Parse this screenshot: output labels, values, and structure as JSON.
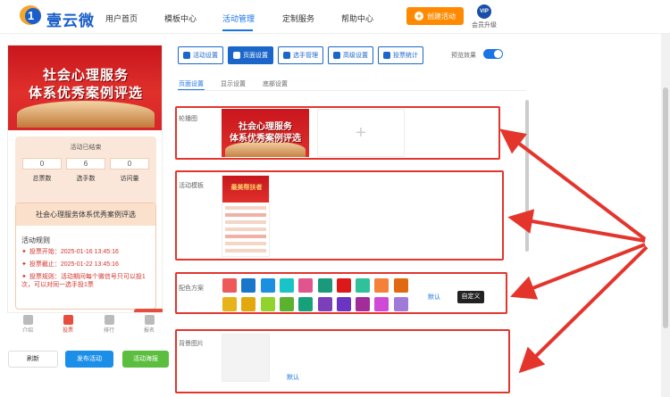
{
  "header": {
    "brand": "壹云微",
    "logo_digit": "1",
    "nav": [
      {
        "label": "用户首页"
      },
      {
        "label": "模板中心"
      },
      {
        "label": "活动管理",
        "active": true
      },
      {
        "label": "定制服务"
      },
      {
        "label": "帮助中心"
      }
    ],
    "create_label": "创建活动",
    "vip_badge": "VIP",
    "vip_label": "会员升级"
  },
  "preview": {
    "banner_line1": "社会心理服务",
    "banner_line2": "体系优秀案例评选",
    "status": "活动已结束",
    "stats": [
      {
        "value": "0",
        "label": "总票数"
      },
      {
        "value": "6",
        "label": "选手数"
      },
      {
        "value": "0",
        "label": "访问量"
      }
    ],
    "rules_title": "社会心理服务体系优秀案例评选",
    "rules_heading": "活动规则",
    "rules": [
      "投票开始：2025-01-16 13:45:16",
      "投票截止：2025-01-22 13:45:16",
      "投票规则：活动期间每个微信号只可以投1次，可以对同一选手投1票"
    ],
    "tabs": [
      {
        "label": "介绍"
      },
      {
        "label": "投票",
        "active": true
      },
      {
        "label": "排行"
      },
      {
        "label": "报名"
      }
    ],
    "buttons": {
      "refresh": "刷新",
      "publish": "发布活动",
      "poster": "活动海报"
    }
  },
  "settings": {
    "toolbar": [
      {
        "label": "活动设置"
      },
      {
        "label": "页面设置",
        "active": true
      },
      {
        "label": "选手管理"
      },
      {
        "label": "高级设置"
      },
      {
        "label": "投票统计"
      }
    ],
    "preview_toggle_label": "预览效果",
    "preview_toggle_on": true,
    "subtabs": [
      {
        "label": "页面设置",
        "active": true
      },
      {
        "label": "显示设置"
      },
      {
        "label": "底部设置"
      }
    ],
    "carousel_label": "轮播图",
    "carousel_add": "+",
    "template_label": "活动模板",
    "template_thumb_title": "最美帮扶者",
    "color_label": "配色方案",
    "color_swatches_row1": [
      "#ee5a5a",
      "#1a76c8",
      "#1c8fe0",
      "#19c3c6",
      "#e0558d",
      "#1a9a7a",
      "#dd1818",
      "#2fc19a",
      "#f4803a",
      "#e06a12"
    ],
    "color_swatches_row2": [
      "#e8b21a",
      "#e2a80c",
      "#8fd32c",
      "#5ab22f",
      "#17a07c",
      "#7b3fb9",
      "#6a35c2",
      "#a12c9a",
      "#d04ad8",
      "#a07ad8"
    ],
    "color_default": "默认",
    "color_custom": "自定义",
    "bg_label": "背景图片",
    "bg_default": "默认"
  }
}
